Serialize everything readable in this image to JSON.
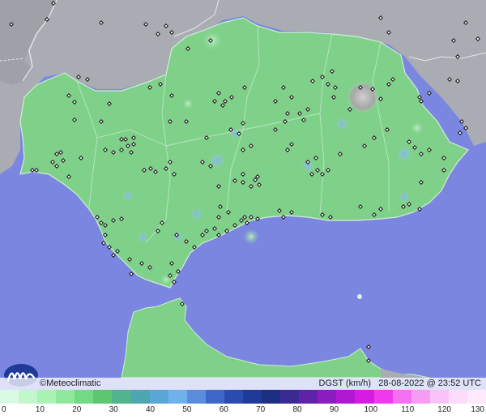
{
  "brand": {
    "copyright_text": "©Meteoclimatic"
  },
  "stamp": {
    "variable": "DGST (km/h)",
    "datetime": "28-08-2022 @ 23:52 UTC"
  },
  "legend": {
    "ticks": [
      "0",
      "10",
      "20",
      "30",
      "40",
      "50",
      "60",
      "70",
      "80",
      "90",
      "100",
      "110",
      "120",
      "130"
    ],
    "colors": [
      "#dafbe3",
      "#c2f6cb",
      "#a9f3b4",
      "#8fe89c",
      "#72d985",
      "#5cc771",
      "#52b48f",
      "#4ea6b1",
      "#5aa6d6",
      "#6fb1ec",
      "#5a8edc",
      "#3e68c8",
      "#2a4bb0",
      "#1f3a98",
      "#1d2f82",
      "#3b2a94",
      "#5f22a8",
      "#8a1cc0",
      "#b018d4",
      "#d61ce0",
      "#ee3aec",
      "#f46ff2",
      "#f79cf5",
      "#fac2f8",
      "#fcdcfa",
      "#fee9fd"
    ]
  },
  "map": {
    "sea_color": "#7b86e0",
    "land_color": "#7fd189",
    "neighbor_color": "#a8abb2",
    "station_color": "#111111"
  }
}
